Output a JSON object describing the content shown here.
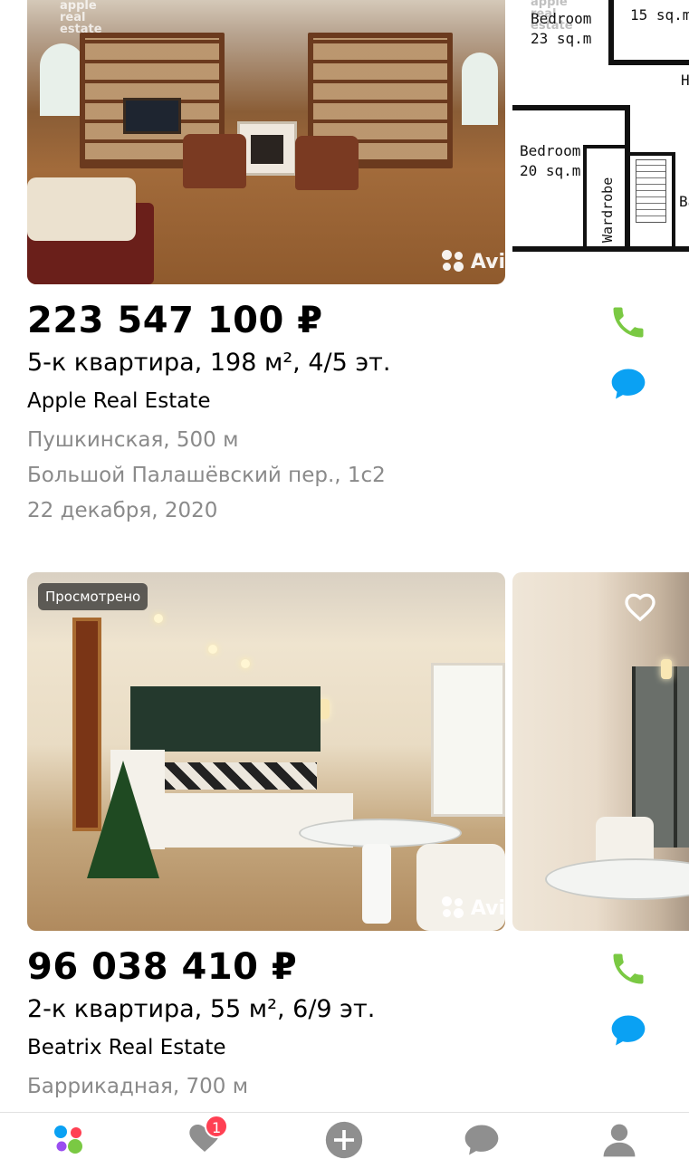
{
  "listings": [
    {
      "price": "223 547 100 ₽",
      "title": "5-к квартира, 198 м², 4/5 эт.",
      "agency": "Apple Real Estate",
      "metro": "Пушкинская, 500 м",
      "address": "Большой Палашёвский пер., 1с2",
      "date": "22 декабря, 2020",
      "photo_watermark_lines": [
        "apple",
        "real",
        "estate"
      ],
      "photo_brand_mark": "Avi",
      "floorplan_labels": {
        "room_a_name": "Bedroom",
        "room_a_area": "23 sq.m",
        "room_b_area": "15 sq.m",
        "room_c_name": "Bedroom",
        "room_c_area": "20 sq.m",
        "wardrobe": "Wardrobe",
        "bath_partial": "Ba",
        "hall_partial": "H"
      }
    },
    {
      "viewed_label": "Просмотрено",
      "price": "96 038 410 ₽",
      "title": "2-к квартира, 55 м², 6/9 эт.",
      "agency": "Beatrix Real Estate",
      "metro": "Баррикадная, 700 м",
      "photo_brand_mark": "Avi"
    }
  ],
  "tabbar": {
    "favorites_count": "1"
  },
  "colors": {
    "call_green": "#7ac943",
    "message_blue": "#0aa1f3",
    "meta_gray": "#8a8a8a",
    "badge_red": "#ff4053",
    "tab_icon_gray": "#8f8f8f",
    "logo_blue": "#0aa1f3",
    "logo_red": "#ff4053",
    "logo_purple": "#9a4ef0",
    "logo_green": "#7ac943"
  },
  "icons": {
    "call": "phone-icon",
    "message": "chat-bubble-icon",
    "favorite": "heart-outline-icon",
    "tab_home": "avito-logo-icon",
    "tab_favorites": "heart-filled-icon",
    "tab_add": "plus-circle-icon",
    "tab_messages": "chat-bubble-icon",
    "tab_profile": "user-icon"
  }
}
